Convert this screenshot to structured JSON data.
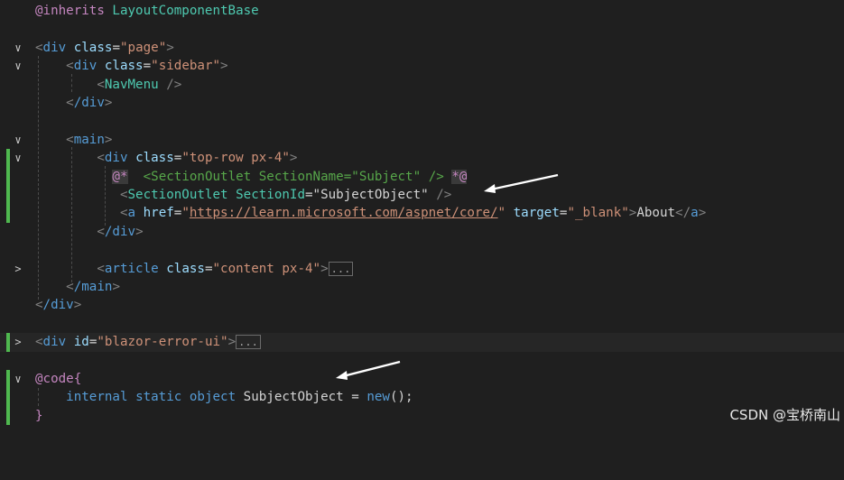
{
  "lines": {
    "inherits": {
      "directive": "@inherits",
      "name": "LayoutComponentBase"
    },
    "div_page": {
      "tag": "div",
      "attr": "class",
      "value": "page"
    },
    "div_sidebar": {
      "tag": "div",
      "attr": "class",
      "value": "sidebar"
    },
    "navmenu": {
      "tag": "NavMenu"
    },
    "div_close": {
      "tag": "/div"
    },
    "main_open": {
      "tag": "main"
    },
    "div_toprow": {
      "tag": "div",
      "attr": "class",
      "value": "top-row px-4"
    },
    "comment": {
      "open": "@*",
      "tag": "SectionOutlet",
      "attr": "SectionName",
      "value": "Subject",
      "close": "*@"
    },
    "section_outlet": {
      "tag": "SectionOutlet",
      "attr": "SectionId",
      "value": "SubjectObject"
    },
    "anchor": {
      "tag": "a",
      "attr1": "href",
      "href": "https://learn.microsoft.com/aspnet/core/",
      "attr2": "target",
      "target": "_blank",
      "text": "About"
    },
    "article": {
      "tag": "article",
      "attr": "class",
      "value": "content px-4",
      "ellipsis": "..."
    },
    "main_close": {
      "tag": "/main"
    },
    "div_error": {
      "tag": "div",
      "attr": "id",
      "value": "blazor-error-ui",
      "ellipsis": "..."
    },
    "code_block": {
      "directive": "@code",
      "open_brace": "{",
      "close_brace": "}"
    },
    "field": {
      "mod1": "internal",
      "mod2": "static",
      "type": "object",
      "name": "SubjectObject",
      "op": "=",
      "ctor": "new",
      "rest": "();"
    }
  },
  "watermark": "CSDN @宝桥南山",
  "colors": {
    "background": "#1f1f1f",
    "tag": "#569cd6",
    "attr": "#9cdcfe",
    "string": "#ce9178",
    "comment": "#57a64a",
    "change_bar": "#4fb84f"
  }
}
